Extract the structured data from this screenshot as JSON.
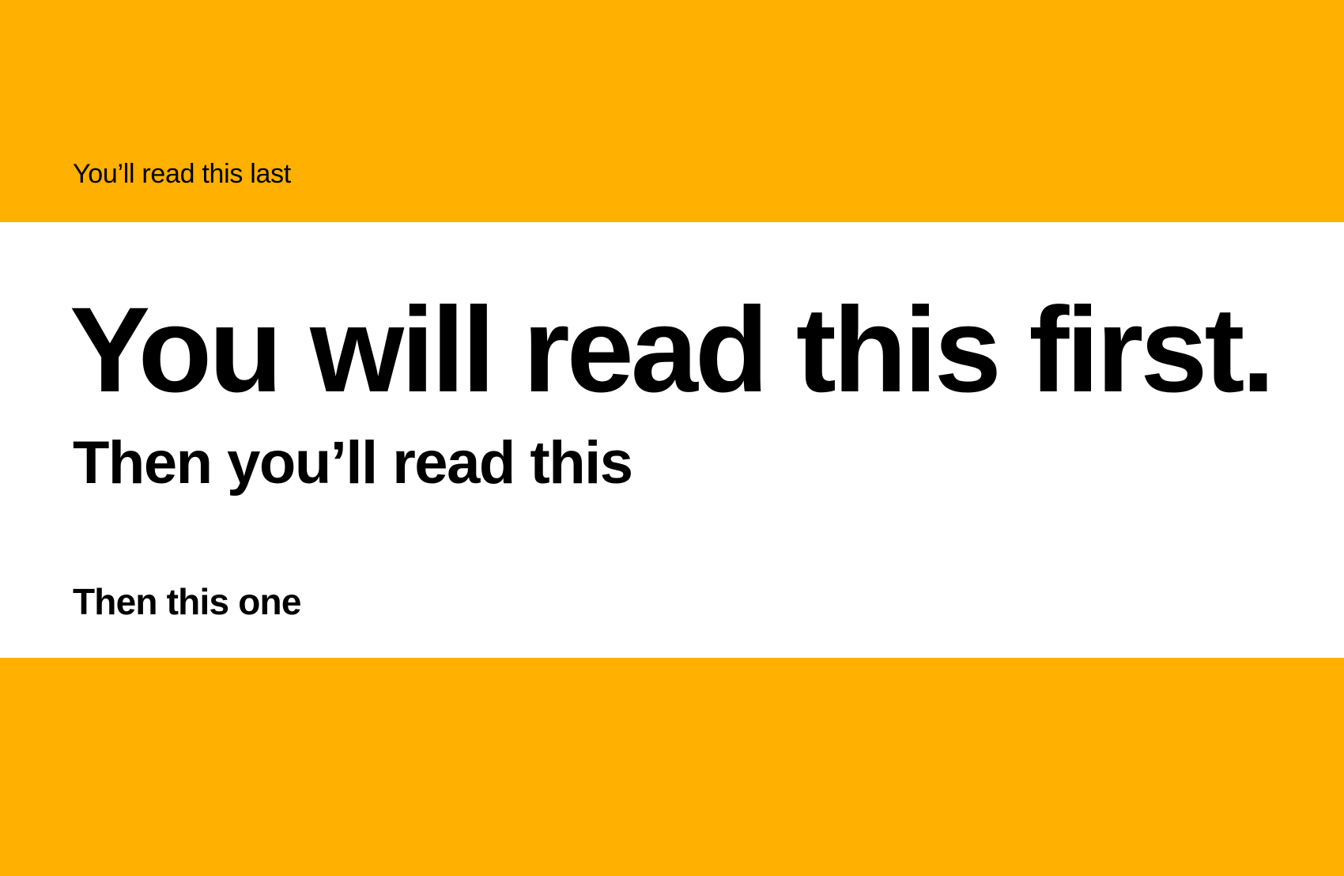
{
  "colors": {
    "accent_band": "#FFB000",
    "background": "#FFFFFF",
    "text": "#000000"
  },
  "texts": {
    "last": "You’ll read this last",
    "first": "You will read this first.",
    "then": "Then you’ll read this",
    "one": "Then this one"
  }
}
